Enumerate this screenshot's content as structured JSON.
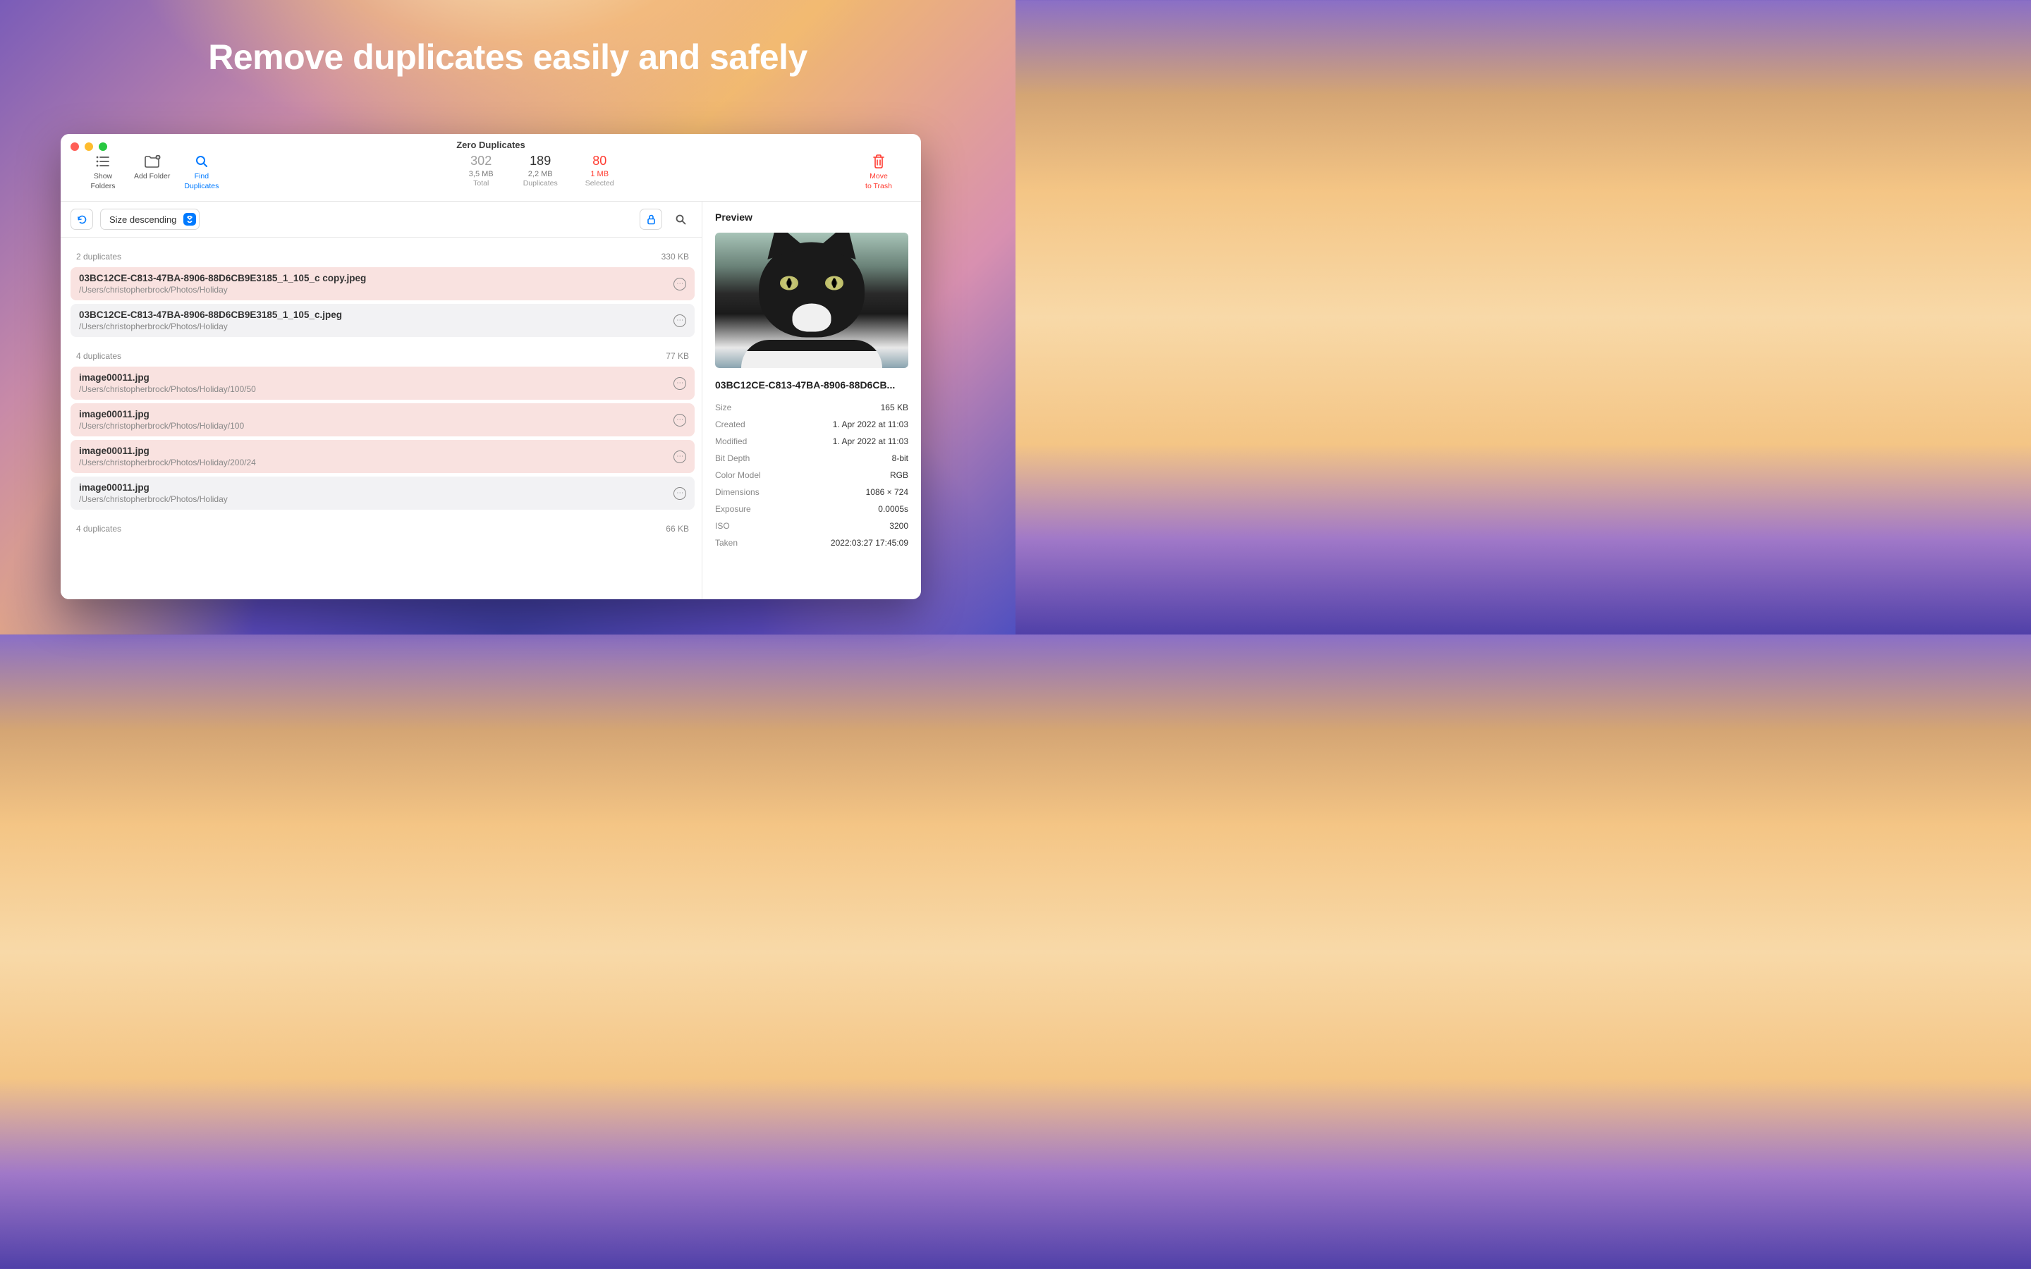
{
  "hero": {
    "title": "Remove duplicates easily and safely"
  },
  "window": {
    "title": "Zero Duplicates"
  },
  "toolbar": {
    "show_folders": "Show\nFolders",
    "add_folder": "Add Folder",
    "find_duplicates": "Find\nDuplicates",
    "move_trash": "Move\nto Trash"
  },
  "stats": {
    "total": {
      "num": "302",
      "size": "3,5 MB",
      "label": "Total"
    },
    "duplicates": {
      "num": "189",
      "size": "2,2 MB",
      "label": "Duplicates"
    },
    "selected": {
      "num": "80",
      "size": "1 MB",
      "label": "Selected"
    }
  },
  "sort": {
    "label": "Size descending"
  },
  "groups": [
    {
      "count_label": "2 duplicates",
      "size": "330 KB",
      "files": [
        {
          "name": "03BC12CE-C813-47BA-8906-88D6CB9E3185_1_105_c copy.jpeg",
          "path": "/Users/christopherbrock/Photos/Holiday",
          "selected": true
        },
        {
          "name": "03BC12CE-C813-47BA-8906-88D6CB9E3185_1_105_c.jpeg",
          "path": "/Users/christopherbrock/Photos/Holiday",
          "selected": false
        }
      ]
    },
    {
      "count_label": "4 duplicates",
      "size": "77 KB",
      "files": [
        {
          "name": "image00011.jpg",
          "path": "/Users/christopherbrock/Photos/Holiday/100/50",
          "selected": true
        },
        {
          "name": "image00011.jpg",
          "path": "/Users/christopherbrock/Photos/Holiday/100",
          "selected": true
        },
        {
          "name": "image00011.jpg",
          "path": "/Users/christopherbrock/Photos/Holiday/200/24",
          "selected": true
        },
        {
          "name": "image00011.jpg",
          "path": "/Users/christopherbrock/Photos/Holiday",
          "selected": false
        }
      ]
    },
    {
      "count_label": "4 duplicates",
      "size": "66 KB",
      "files": []
    }
  ],
  "preview": {
    "title": "Preview",
    "filename": "03BC12CE-C813-47BA-8906-88D6CB...",
    "meta": [
      {
        "key": "Size",
        "val": "165 KB"
      },
      {
        "key": "Created",
        "val": "1. Apr 2022 at 11:03"
      },
      {
        "key": "Modified",
        "val": "1. Apr 2022 at 11:03"
      },
      {
        "key": "Bit Depth",
        "val": "8-bit"
      },
      {
        "key": "Color Model",
        "val": "RGB"
      },
      {
        "key": "Dimensions",
        "val": "1086 × 724"
      },
      {
        "key": "Exposure",
        "val": "0.0005s"
      },
      {
        "key": "ISO",
        "val": "3200"
      },
      {
        "key": "Taken",
        "val": "2022:03:27 17:45:09"
      }
    ]
  }
}
